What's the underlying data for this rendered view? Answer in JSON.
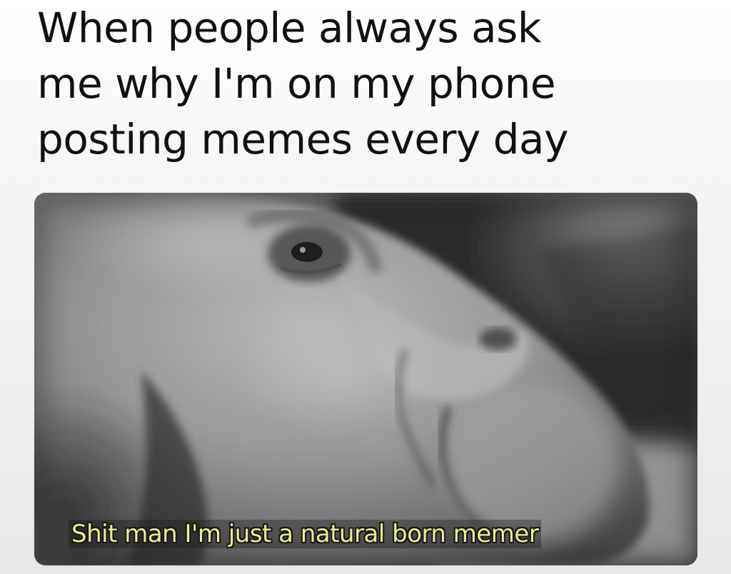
{
  "meme": {
    "caption_lines": [
      "When people always ask",
      "me why I'm on my phone",
      "posting memes every day"
    ],
    "subtitle": "Shit man I'm just a natural born memer"
  },
  "photo": {
    "style": "black-and-white close-up of a man lying on his side",
    "subtitle_color": "#e9ec8e"
  }
}
